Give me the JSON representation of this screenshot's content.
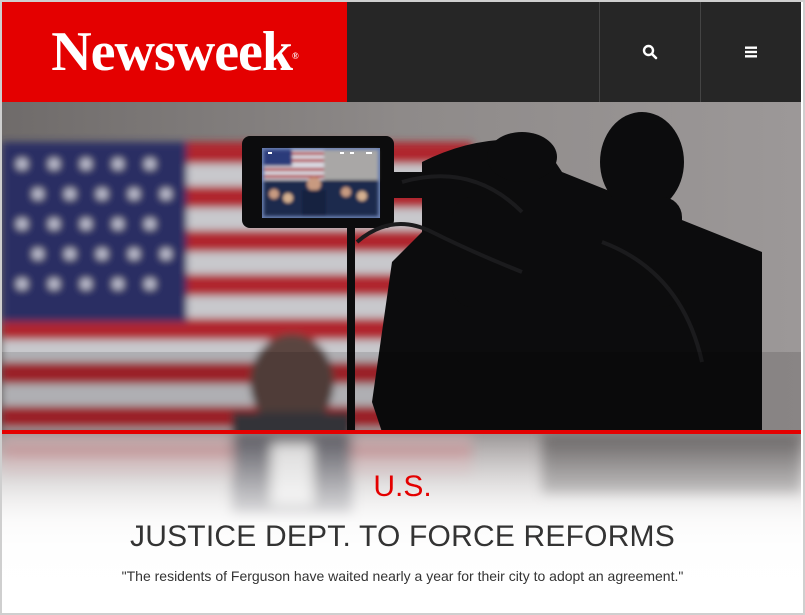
{
  "brand": {
    "logo_text": "Newsweek",
    "trademark": "®",
    "accent": "#e40000",
    "header_bg": "#262626"
  },
  "header": {
    "search_icon": "search-icon",
    "menu_icon": "hamburger-menu-icon"
  },
  "hero": {
    "image_subject": "news-camera-photo"
  },
  "article": {
    "section": "U.S.",
    "headline": "JUSTICE DEPT. TO FORCE REFORMS",
    "dek": "\"The residents of Ferguson have waited nearly a year for their city to adopt an agreement.\""
  }
}
